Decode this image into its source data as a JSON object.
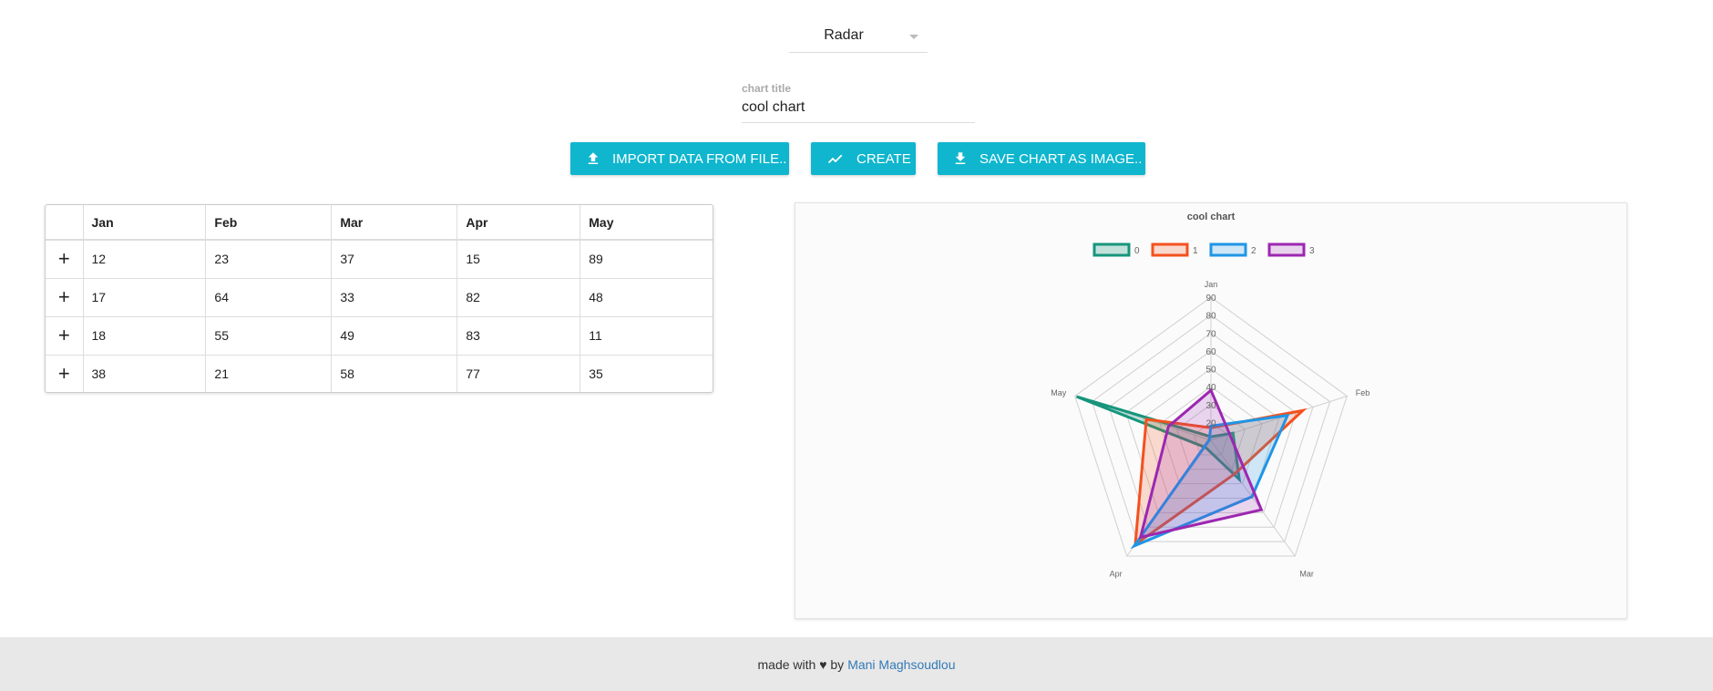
{
  "chart_type_select": {
    "value": "Radar"
  },
  "title_field": {
    "label": "chart title",
    "value": "cool chart"
  },
  "buttons": {
    "import": "IMPORT DATA FROM FILE..",
    "create": "CREATE",
    "save": "SAVE CHART AS IMAGE.."
  },
  "table": {
    "headers": [
      "Jan",
      "Feb",
      "Mar",
      "Apr",
      "May"
    ],
    "add_row_symbol": "+",
    "rows": [
      [
        "12",
        "23",
        "37",
        "15",
        "89"
      ],
      [
        "17",
        "64",
        "33",
        "82",
        "48"
      ],
      [
        "18",
        "55",
        "49",
        "83",
        "11"
      ],
      [
        "38",
        "21",
        "58",
        "77",
        "35"
      ]
    ]
  },
  "footer": {
    "prefix": "made with ♥ by",
    "author": "Mani Maghsoudlou"
  },
  "colors": {
    "accent": "#0fb6ce",
    "link": "#337ab7"
  },
  "chart_data": {
    "type": "radar",
    "title": "cool chart",
    "categories": [
      "Jan",
      "Feb",
      "Mar",
      "Apr",
      "May"
    ],
    "r_ticks": [
      20,
      30,
      40,
      50,
      60,
      70,
      80,
      90
    ],
    "r_range": [
      10,
      90
    ],
    "legend_position": "top",
    "series": [
      {
        "name": "0",
        "values": [
          12,
          23,
          37,
          15,
          89
        ],
        "color": "#16957c",
        "fill": "rgba(22,149,124,0.25)"
      },
      {
        "name": "1",
        "values": [
          17,
          64,
          33,
          82,
          48
        ],
        "color": "#f4511e",
        "fill": "rgba(244,81,30,0.2)"
      },
      {
        "name": "2",
        "values": [
          18,
          55,
          49,
          83,
          11
        ],
        "color": "#1e96e6",
        "fill": "rgba(30,150,230,0.2)"
      },
      {
        "name": "3",
        "values": [
          38,
          21,
          58,
          77,
          35
        ],
        "color": "#9c27b0",
        "fill": "rgba(156,39,176,0.18)"
      }
    ]
  }
}
